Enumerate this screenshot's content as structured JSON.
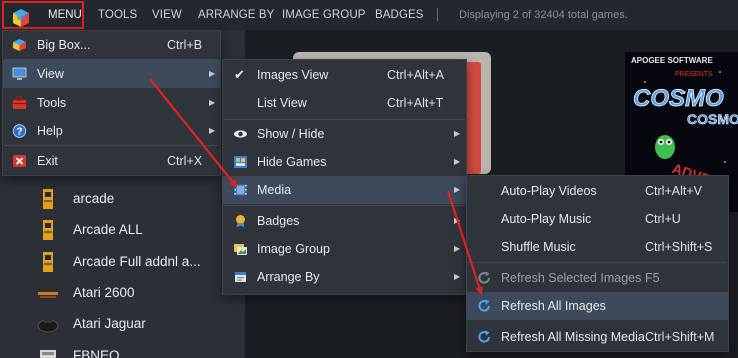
{
  "topbar": {
    "items": [
      "MENU",
      "TOOLS",
      "VIEW",
      "ARRANGE BY",
      "IMAGE GROUP",
      "BADGES"
    ],
    "status": "Displaying 2 of 32404 total games."
  },
  "sidebar": {
    "platforms": [
      {
        "label": "arcade",
        "icon": "arcade-cabinet-icon"
      },
      {
        "label": "Arcade ALL",
        "icon": "arcade-cabinet-icon"
      },
      {
        "label": "Arcade Full addnl a...",
        "icon": "arcade-cabinet-icon"
      },
      {
        "label": "Atari 2600",
        "icon": "atari-2600-icon"
      },
      {
        "label": "Atari Jaguar",
        "icon": "atari-jaguar-icon"
      },
      {
        "label": "FBNEO",
        "icon": "fbneo-icon"
      }
    ]
  },
  "menu_main": {
    "items": [
      {
        "label": "Big Box...",
        "shortcut": "Ctrl+B",
        "icon": "bigbox-icon"
      },
      {
        "label": "View",
        "shortcut": "",
        "icon": "monitor-icon",
        "submenu": true
      },
      {
        "label": "Tools",
        "shortcut": "",
        "icon": "toolbox-icon",
        "submenu": true
      },
      {
        "label": "Help",
        "shortcut": "",
        "icon": "help-icon",
        "submenu": true
      },
      {
        "label": "Exit",
        "shortcut": "Ctrl+X",
        "icon": "exit-icon"
      }
    ]
  },
  "menu_view": {
    "items": [
      {
        "label": "Images View",
        "shortcut": "Ctrl+Alt+A",
        "icon": "checkmark-icon"
      },
      {
        "label": "List View",
        "shortcut": "Ctrl+Alt+T",
        "icon": ""
      },
      {
        "label": "Show / Hide",
        "shortcut": "",
        "icon": "eye-icon",
        "submenu": true
      },
      {
        "label": "Hide Games",
        "shortcut": "",
        "icon": "hide-games-icon",
        "submenu": true
      },
      {
        "label": "Media",
        "shortcut": "",
        "icon": "film-icon",
        "submenu": true
      },
      {
        "label": "Badges",
        "shortcut": "",
        "icon": "badge-icon",
        "submenu": true
      },
      {
        "label": "Image Group",
        "shortcut": "",
        "icon": "image-group-icon",
        "submenu": true
      },
      {
        "label": "Arrange By",
        "shortcut": "",
        "icon": "arrange-icon",
        "submenu": true
      }
    ]
  },
  "menu_media": {
    "items": [
      {
        "label": "Auto-Play Videos",
        "shortcut": "Ctrl+Alt+V",
        "icon": ""
      },
      {
        "label": "Auto-Play Music",
        "shortcut": "Ctrl+U",
        "icon": ""
      },
      {
        "label": "Shuffle Music",
        "shortcut": "Ctrl+Shift+S",
        "icon": ""
      },
      {
        "label": "Refresh Selected Images",
        "shortcut": "F5",
        "icon": "refresh-icon"
      },
      {
        "label": "Refresh All Images",
        "shortcut": "",
        "icon": "refresh-icon"
      },
      {
        "label": "Refresh All Missing Media",
        "shortcut": "Ctrl+Shift+M",
        "icon": "refresh-icon"
      }
    ]
  },
  "tiles": {
    "tile2_lines": [
      "APOGEE SOFTWARE",
      "PRESENTS",
      "COSMO",
      "COSMO",
      "ADVENT"
    ]
  },
  "colors": {
    "highlight": "#3d4a5c",
    "annotation": "#e0221e",
    "menu_bg": "#2f333a"
  }
}
